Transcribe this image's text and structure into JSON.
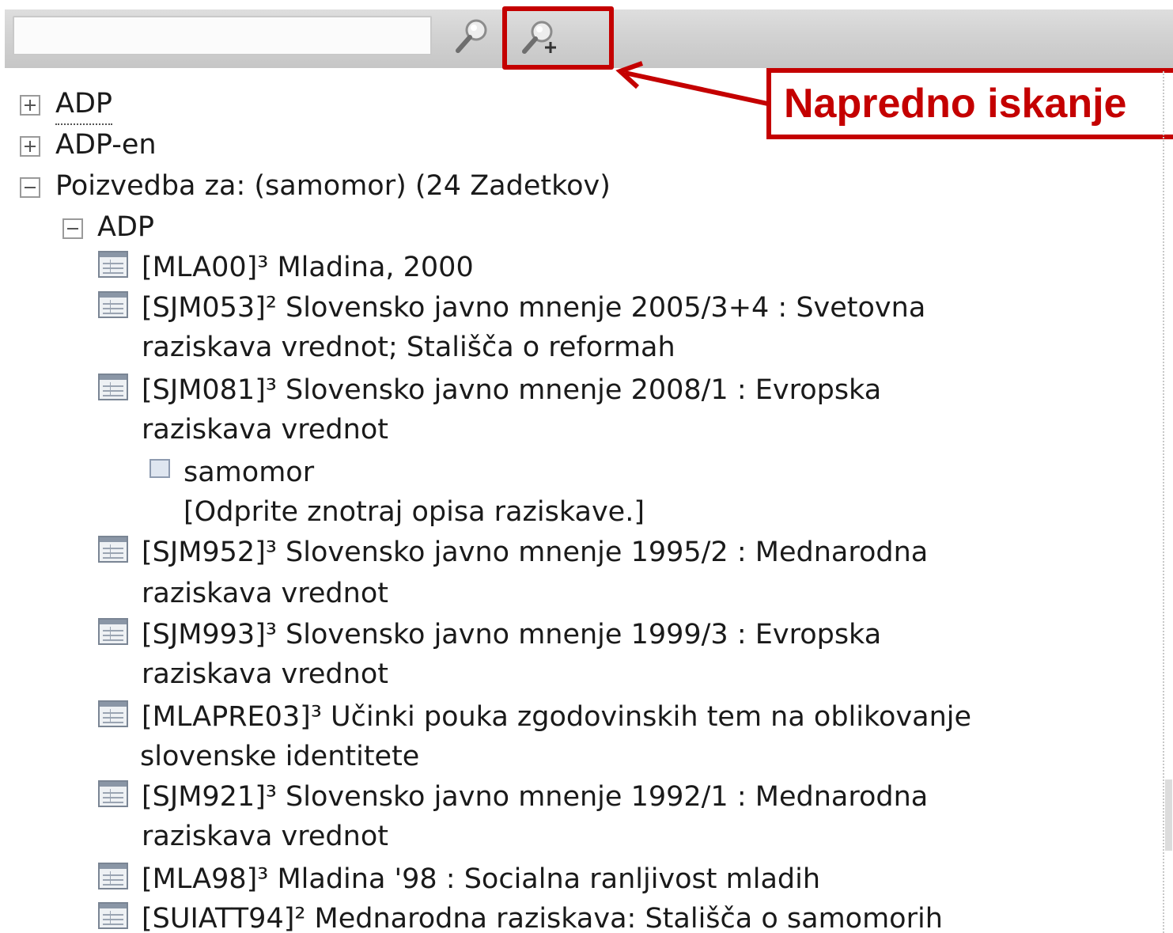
{
  "search": {
    "value": "",
    "placeholder": ""
  },
  "toolbar": {
    "search_icon": "magnifier-icon",
    "advanced_icon": "magnifier-plus-icon"
  },
  "callout": {
    "label": "Napredno iskanje",
    "color": "#c40000"
  },
  "tree": {
    "root_adp": "ADP",
    "root_adp_en": "ADP-en",
    "query": "Poizvedba za: (samomor) (24 Zadetkov)",
    "sub_adp": "ADP",
    "results": [
      {
        "line1": "[MLA00]³ Mladina, 2000"
      },
      {
        "line1": "[SJM053]² Slovensko javno mnenje 2005/3+4 : Svetovna",
        "line2": "raziskava vrednot; Stališča o reformah"
      },
      {
        "line1": "[SJM081]³ Slovensko javno mnenje 2008/1 : Evropska",
        "line2": "raziskava vrednot"
      },
      {
        "line1": "[SJM952]³ Slovensko javno mnenje 1995/2 : Mednarodna",
        "line2": "raziskava vrednot"
      },
      {
        "line1": "[SJM993]³ Slovensko javno mnenje 1999/3 : Evropska",
        "line2": "raziskava vrednot"
      },
      {
        "line1": "[MLAPRE03]³ Učinki pouka zgodovinskih tem na oblikovanje",
        "line2": "slovenske identitete"
      },
      {
        "line1": "[SJM921]³ Slovensko javno mnenje 1992/1 : Mednarodna",
        "line2": "raziskava vrednot"
      },
      {
        "line1": "[MLA98]³ Mladina '98 : Socialna ranljivost mladih"
      },
      {
        "line1": "[SUIATT94]² Mednarodna raziskava: Stališča o samomorih"
      }
    ],
    "variable": {
      "name": "samomor",
      "hint": "[Odprite znotraj opisa raziskave.]"
    }
  }
}
